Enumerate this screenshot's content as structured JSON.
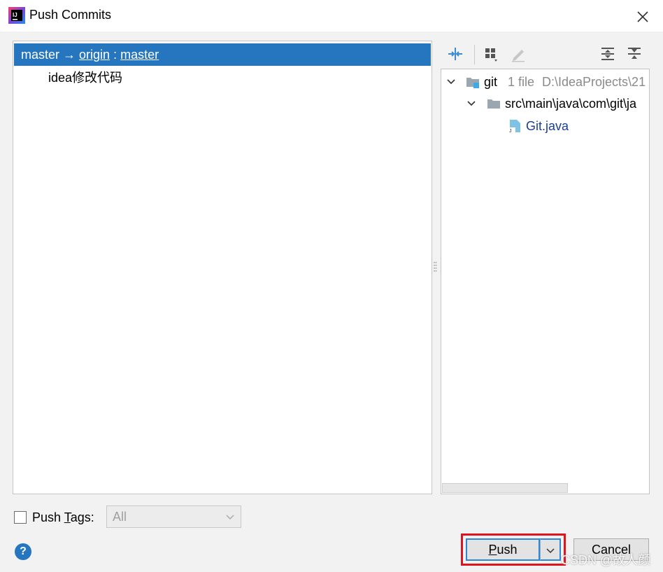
{
  "window": {
    "title": "Push Commits"
  },
  "colors": {
    "selection": "#2675bf",
    "accent": "#2e87d6",
    "highlight": "#e0141e"
  },
  "branch": {
    "local": "master",
    "arrow": "→",
    "remote": "origin",
    "separator": ":",
    "remote_branch": "master"
  },
  "commits": [
    {
      "message": "idea修改代码"
    }
  ],
  "toolbar": {
    "icons": [
      "expand-diff-icon",
      "group-by-icon",
      "edit-icon",
      "expand-all-icon",
      "collapse-all-icon"
    ]
  },
  "tree": {
    "root": {
      "name": "git",
      "count": "1 file",
      "path": "D:\\IdeaProjects\\21"
    },
    "folder": {
      "name": "src\\main\\java\\com\\git\\ja"
    },
    "file": {
      "name": "Git.java"
    }
  },
  "push_tags": {
    "label_prefix": "Push ",
    "label_mnemonic": "T",
    "label_suffix": "ags:",
    "select_value": "All"
  },
  "buttons": {
    "help": "?",
    "push_mnemonic": "P",
    "push_rest": "ush",
    "cancel": "Cancel"
  },
  "watermark": "CSDN @故人颜"
}
